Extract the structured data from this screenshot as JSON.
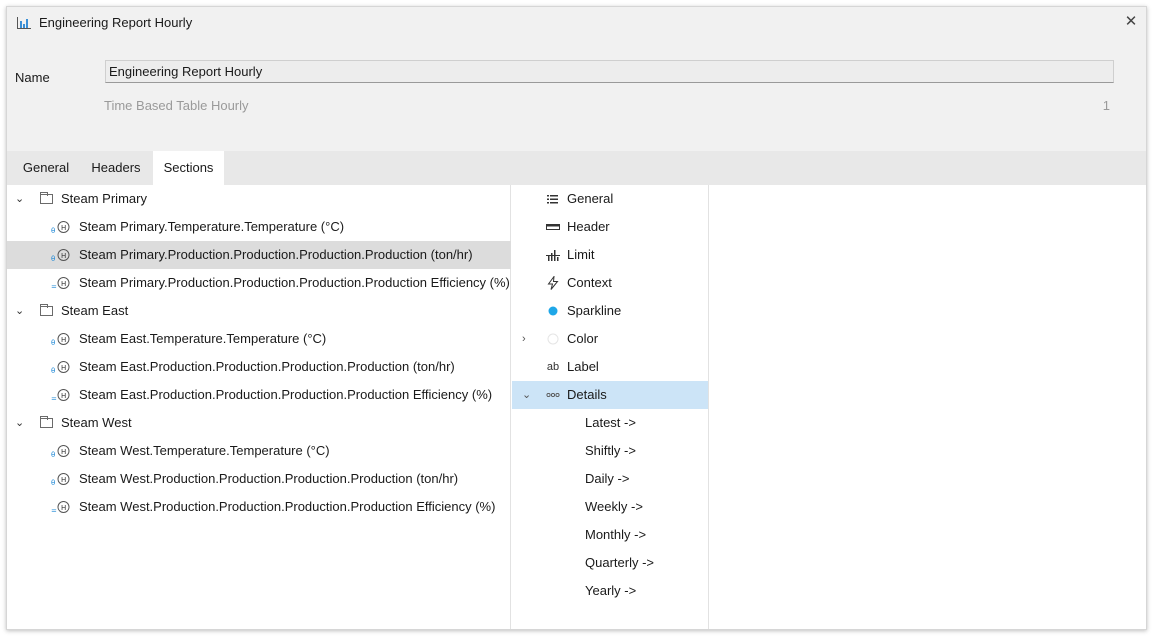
{
  "window": {
    "title": "Engineering Report Hourly",
    "close_glyph": "✕"
  },
  "form": {
    "name_label": "Name",
    "name_value": "Engineering Report Hourly",
    "subtitle": "Time Based Table Hourly",
    "count": "1"
  },
  "tabs": [
    {
      "label": "General",
      "active": false
    },
    {
      "label": "Headers",
      "active": false
    },
    {
      "label": "Sections",
      "active": true
    }
  ],
  "tree": [
    {
      "type": "group",
      "label": "Steam Primary"
    },
    {
      "type": "signal",
      "label": "Steam Primary.Temperature.Temperature (°C)",
      "icon": "temperature-signal-icon"
    },
    {
      "type": "signal",
      "label": "Steam Primary.Production.Production.Production.Production (ton/hr)",
      "icon": "production-signal-icon",
      "selected": true
    },
    {
      "type": "signal",
      "label": "Steam Primary.Production.Production.Production.Production Efficiency (%)",
      "icon": "efficiency-signal-icon"
    },
    {
      "type": "group",
      "label": "Steam East"
    },
    {
      "type": "signal",
      "label": "Steam East.Temperature.Temperature (°C)",
      "icon": "temperature-signal-icon"
    },
    {
      "type": "signal",
      "label": "Steam East.Production.Production.Production.Production (ton/hr)",
      "icon": "production-signal-icon"
    },
    {
      "type": "signal",
      "label": "Steam East.Production.Production.Production.Production Efficiency (%)",
      "icon": "efficiency-signal-icon"
    },
    {
      "type": "group",
      "label": "Steam West"
    },
    {
      "type": "signal",
      "label": "Steam West.Temperature.Temperature (°C)",
      "icon": "temperature-signal-icon"
    },
    {
      "type": "signal",
      "label": "Steam West.Production.Production.Production.Production (ton/hr)",
      "icon": "production-signal-icon"
    },
    {
      "type": "signal",
      "label": "Steam West.Production.Production.Production.Production Efficiency (%)",
      "icon": "efficiency-signal-icon"
    }
  ],
  "menu": {
    "items": [
      {
        "label": "General",
        "icon": "list-icon"
      },
      {
        "label": "Header",
        "icon": "header-icon"
      },
      {
        "label": "Limit",
        "icon": "limit-icon"
      },
      {
        "label": "Context",
        "icon": "lightning-icon"
      },
      {
        "label": "Sparkline",
        "icon": "dot-icon"
      },
      {
        "label": "Color",
        "icon": "color-circle-icon"
      },
      {
        "label": "Label",
        "icon": "label-ab-icon"
      },
      {
        "label": "Details",
        "icon": "ellipsis-icon"
      }
    ],
    "details_children": [
      "Latest ->",
      "Shiftly ->",
      "Daily ->",
      "Weekly ->",
      "Monthly ->",
      "Quarterly ->",
      "Yearly ->"
    ],
    "ab_glyph": "ab",
    "accent_color": "#1ea7e8",
    "selected_bg": "#cce4f7"
  }
}
